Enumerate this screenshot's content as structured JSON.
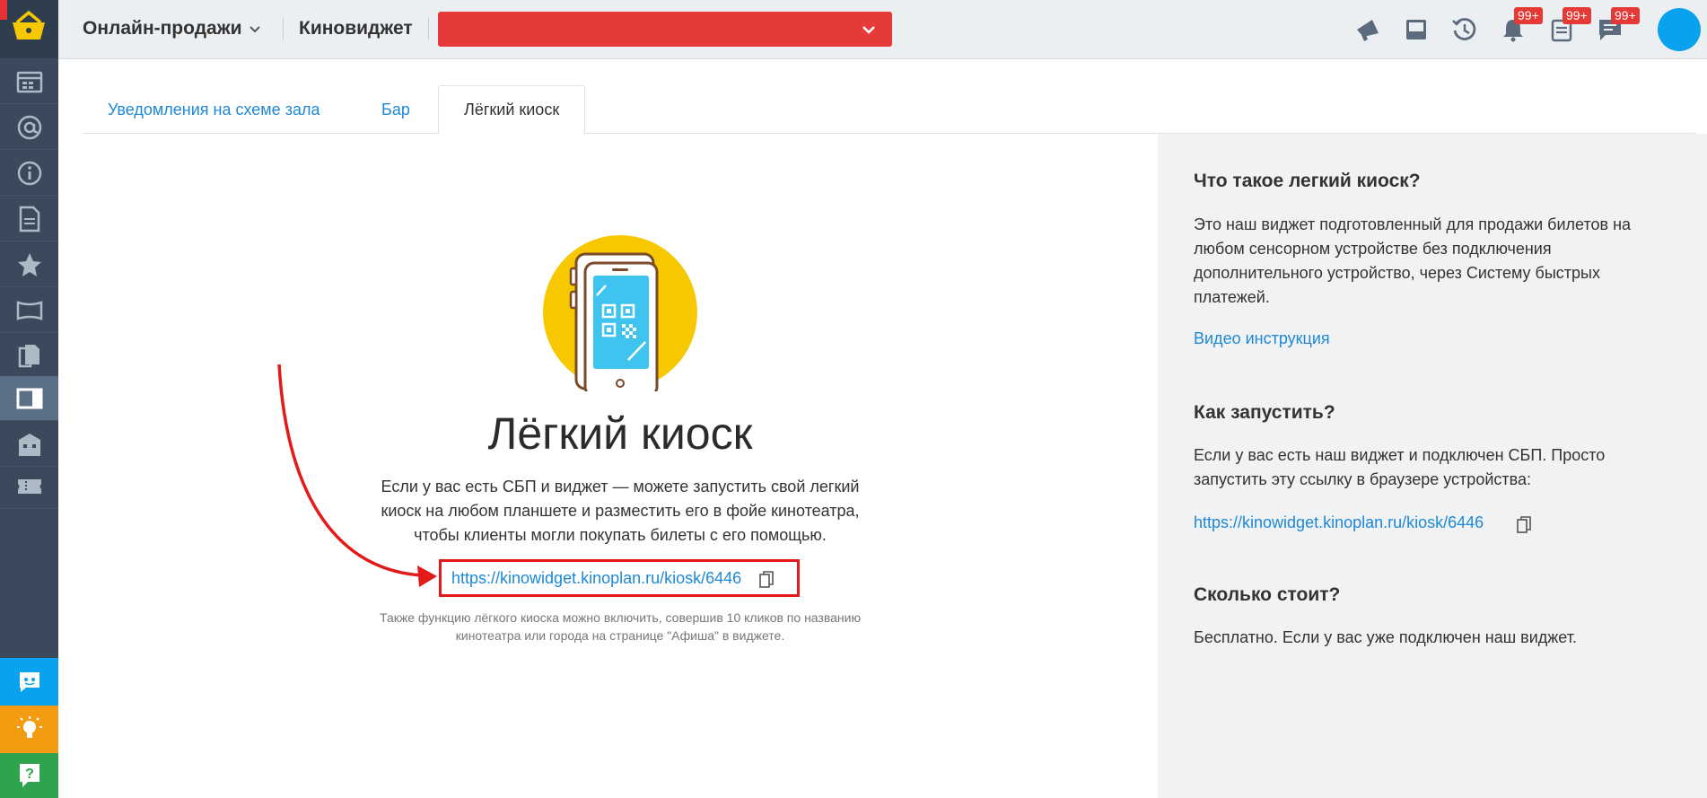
{
  "header": {
    "section_title": "Онлайн-продажи",
    "product_title": "Киновиджет",
    "badges": [
      "99+",
      "99+",
      "99+"
    ]
  },
  "sidebar": {
    "icons": [
      "calendar-icon",
      "at-icon",
      "info-icon",
      "document-icon",
      "star-icon",
      "map-icon",
      "copy-icon",
      "widget-icon",
      "building-icon",
      "tickets-icon"
    ],
    "bottom": [
      "chat-icon",
      "lightbulb-icon",
      "help-icon"
    ]
  },
  "tabs": [
    {
      "label": "Уведомления на схеме зала"
    },
    {
      "label": "Бар"
    },
    {
      "label": "Лёгкий киоск",
      "active": true
    }
  ],
  "main": {
    "title": "Лёгкий киоск",
    "description": "Если у вас есть СБП и виджет — можете запустить свой легкий киоск на любом планшете и разместить его в фойе кинотеатра, чтобы клиенты могли покупать билеты с его помощью.",
    "link": "https://kinowidget.kinoplan.ru/kiosk/6446",
    "note": "Также функцию лёгкого киоска можно включить, совершив 10 кликов по названию кинотеатра или города на странице \"Афиша\" в виджете."
  },
  "info": {
    "q1": "Что такое легкий киоск?",
    "a1": "Это наш виджет подготовленный для продажи билетов на любом сенсорном устройстве без подключения дополнительного устройство, через Систему быстрых платежей.",
    "video_link": "Видео инструкция",
    "q2": "Как запустить?",
    "a2": "Если у вас есть наш виджет и подключен СБП. Просто запустить эту ссылку в браузере устройства:",
    "link": "https://kinowidget.kinoplan.ru/kiosk/6446",
    "q3": "Сколько стоит?",
    "a3": "Бесплатно. Если у вас уже подключен наш виджет."
  },
  "colors": {
    "sidebar": "#3a4a5c",
    "accent_link": "#1e88d6",
    "highlight_red": "#e21a1a",
    "illustration_yellow": "#f7c800",
    "screen_blue": "#3fc4f0"
  }
}
